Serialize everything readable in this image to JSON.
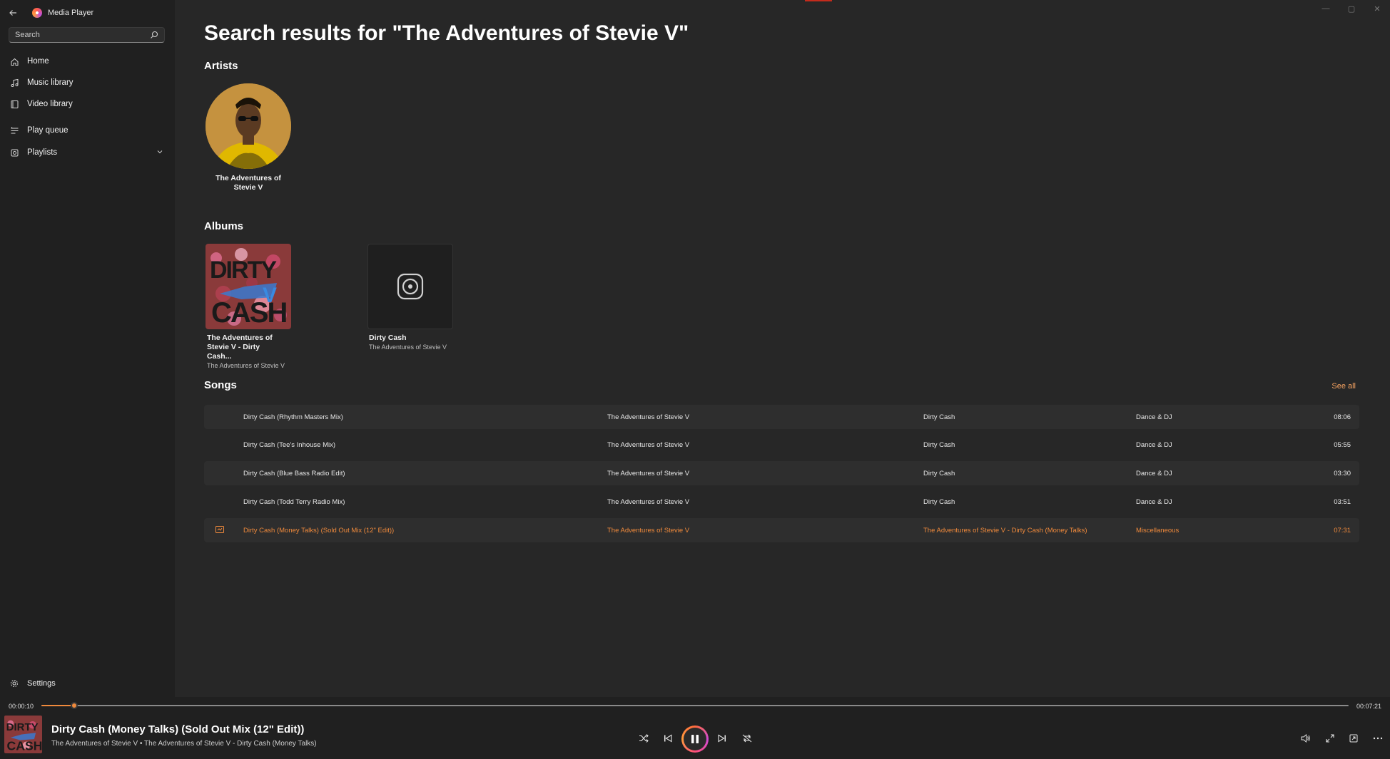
{
  "app": {
    "title": "Media Player",
    "back_icon": "arrow-left-icon",
    "logo_icon": "media-player-logo-icon"
  },
  "search": {
    "placeholder": "Search",
    "value": ""
  },
  "nav": [
    {
      "label": "Home",
      "icon": "home-icon"
    },
    {
      "label": "Music library",
      "icon": "music-note-icon"
    },
    {
      "label": "Video library",
      "icon": "video-icon"
    },
    {
      "label": "Play queue",
      "icon": "queue-icon"
    },
    {
      "label": "Playlists",
      "icon": "playlist-icon",
      "expandable": true
    }
  ],
  "settings": {
    "label": "Settings",
    "icon": "gear-icon"
  },
  "main": {
    "title": "Search results for \"The Adventures of Stevie V\"",
    "artists_heading": "Artists",
    "artists": [
      {
        "name": "The Adventures of Stevie V"
      }
    ],
    "albums_heading": "Albums",
    "albums": [
      {
        "title": "The Adventures of Stevie V - Dirty Cash...",
        "artist": "The Adventures of Stevie V",
        "art": "dirty-cash-cover"
      },
      {
        "title": "Dirty Cash",
        "artist": "The Adventures of Stevie V",
        "art": "placeholder-disc"
      }
    ],
    "songs_heading": "Songs",
    "see_all": "See all",
    "songs": [
      {
        "title": "Dirty Cash (Rhythm Masters Mix)",
        "artist": "The Adventures of Stevie V",
        "album": "Dirty Cash",
        "genre": "Dance & DJ",
        "duration": "08:06"
      },
      {
        "title": "Dirty Cash (Tee's Inhouse Mix)",
        "artist": "The Adventures of Stevie V",
        "album": "Dirty Cash",
        "genre": "Dance & DJ",
        "duration": "05:55"
      },
      {
        "title": "Dirty Cash (Blue Bass Radio Edit)",
        "artist": "The Adventures of Stevie V",
        "album": "Dirty Cash",
        "genre": "Dance & DJ",
        "duration": "03:30"
      },
      {
        "title": "Dirty Cash (Todd Terry Radio Mix)",
        "artist": "The Adventures of Stevie V",
        "album": "Dirty Cash",
        "genre": "Dance & DJ",
        "duration": "03:51"
      },
      {
        "title": "Dirty Cash (Money Talks) (Sold Out Mix (12\" Edit))",
        "artist": "The Adventures of Stevie V",
        "album": "The Adventures of Stevie V - Dirty Cash (Money Talks)",
        "genre": "Miscellaneous",
        "duration": "07:31",
        "playing": true
      }
    ]
  },
  "player": {
    "elapsed": "00:00:10",
    "total": "00:07:21",
    "progress": 0.025,
    "track_title": "Dirty Cash (Money Talks) (Sold Out Mix (12\" Edit))",
    "track_subtitle": "The Adventures of Stevie V • The Adventures of Stevie V - Dirty Cash (Money Talks)",
    "accent_color": "#f08a3c"
  }
}
